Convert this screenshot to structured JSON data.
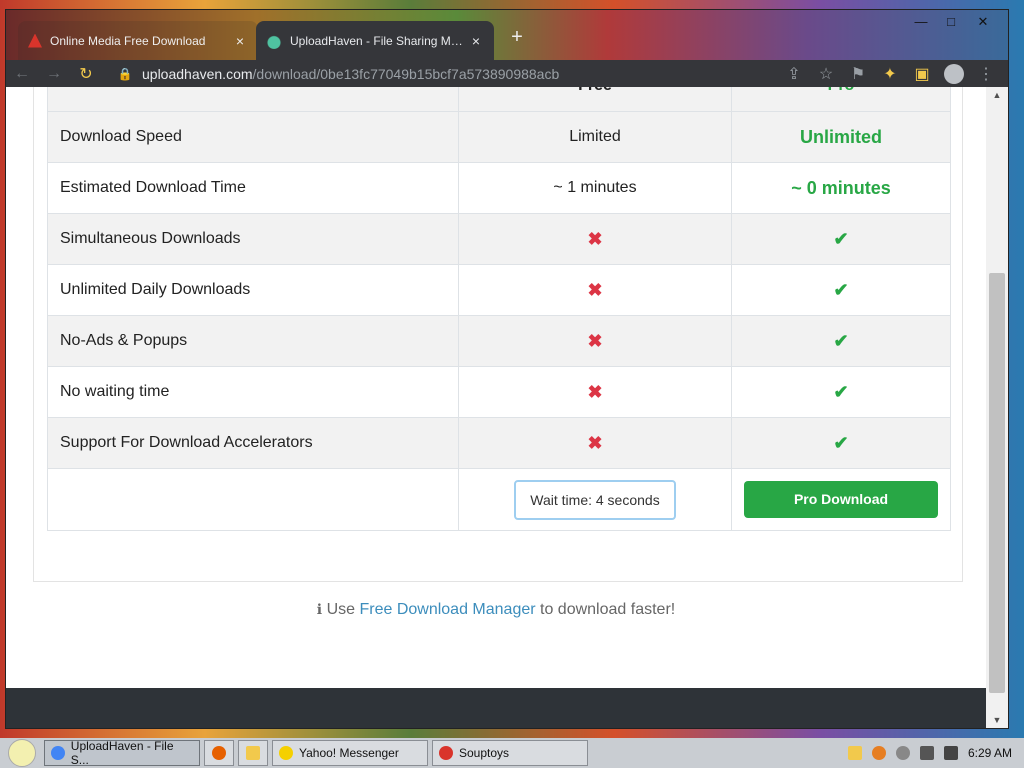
{
  "browser": {
    "tabs": [
      {
        "title": "Online Media Free Download",
        "close": "×"
      },
      {
        "title": "UploadHaven - File Sharing Made Simple",
        "close": "×"
      }
    ],
    "new_tab": "+",
    "url_host": "uploadhaven.com",
    "url_path": "/download/0be13fc77049b15bcf7a573890988acb",
    "controls": {
      "back": "←",
      "forward": "→",
      "reload": "↻",
      "lock": "🔒"
    },
    "window_buttons": {
      "minimize": "—",
      "restore": "□",
      "close": "✕"
    }
  },
  "table": {
    "header": {
      "free": "Free",
      "pro": "Pro"
    },
    "rows": [
      {
        "feature": "Download Speed",
        "free": "Limited",
        "pro": "Unlimited"
      },
      {
        "feature": "Estimated Download Time",
        "free": "~ 1 minutes",
        "pro": "~ 0 minutes"
      },
      {
        "feature": "Simultaneous Downloads",
        "free": "✖",
        "pro": "✔"
      },
      {
        "feature": "Unlimited Daily Downloads",
        "free": "✖",
        "pro": "✔"
      },
      {
        "feature": "No-Ads & Popups",
        "free": "✖",
        "pro": "✔"
      },
      {
        "feature": "No waiting time",
        "free": "✖",
        "pro": "✔"
      },
      {
        "feature": "Support For Download Accelerators",
        "free": "✖",
        "pro": "✔"
      }
    ],
    "wait_text": "Wait time: 4 seconds",
    "pro_button": "Pro Download"
  },
  "download_manager": {
    "prefix": "Use",
    "link": "Free Download Manager",
    "suffix": "to download faster!",
    "icon": "ℹ"
  },
  "taskbar": {
    "tasks": [
      {
        "label": "UploadHaven - File S..."
      },
      {
        "label": "Yahoo! Messenger"
      },
      {
        "label": "Souptoys"
      }
    ],
    "clock": "6:29 AM"
  },
  "colors": {
    "accent_green": "#28a745",
    "x_red": "#dc3545",
    "link_blue": "#3c8dbc"
  }
}
